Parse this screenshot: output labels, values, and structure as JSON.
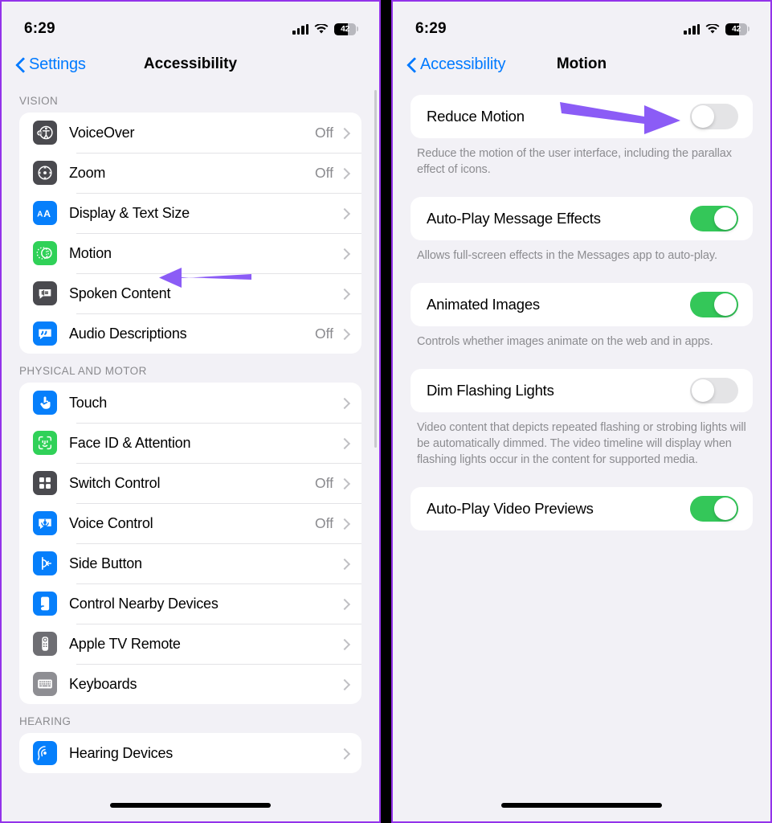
{
  "status_bar": {
    "time": "6:29",
    "battery_percent": "42",
    "cellular_icon": "cellular-bars-icon",
    "wifi_icon": "wifi-icon",
    "battery_icon": "battery-icon"
  },
  "colors": {
    "accent_blue": "#007AFF",
    "toggle_on_green": "#34C759",
    "toggle_off_gray": "#E4E4E6",
    "annotation_purple": "#8B5CF6",
    "page_background": "#F2F1F6",
    "card_background": "#FFFFFF"
  },
  "left_panel": {
    "nav": {
      "back_label": "Settings",
      "title": "Accessibility",
      "back_icon": "chevron-left-icon"
    },
    "sections": [
      {
        "header": "VISION",
        "rows": [
          {
            "label": "VoiceOver",
            "value": "Off",
            "icon": "voiceover-icon",
            "icon_bg": "#4A4A4F",
            "chevron": "chevron-right-icon"
          },
          {
            "label": "Zoom",
            "value": "Off",
            "icon": "zoom-icon",
            "icon_bg": "#4A4A4F",
            "chevron": "chevron-right-icon"
          },
          {
            "label": "Display & Text Size",
            "value": "",
            "icon": "display-text-size-icon",
            "icon_bg": "#067FFB",
            "chevron": "chevron-right-icon"
          },
          {
            "label": "Motion",
            "value": "",
            "icon": "motion-icon",
            "icon_bg": "#30D158",
            "chevron": "chevron-right-icon"
          },
          {
            "label": "Spoken Content",
            "value": "",
            "icon": "spoken-content-icon",
            "icon_bg": "#4A4A4F",
            "chevron": "chevron-right-icon"
          },
          {
            "label": "Audio Descriptions",
            "value": "Off",
            "icon": "audio-descriptions-icon",
            "icon_bg": "#067FFB",
            "chevron": "chevron-right-icon"
          }
        ]
      },
      {
        "header": "PHYSICAL AND MOTOR",
        "rows": [
          {
            "label": "Touch",
            "value": "",
            "icon": "touch-icon",
            "icon_bg": "#067FFB",
            "chevron": "chevron-right-icon"
          },
          {
            "label": "Face ID & Attention",
            "value": "",
            "icon": "face-id-icon",
            "icon_bg": "#30D158",
            "chevron": "chevron-right-icon"
          },
          {
            "label": "Switch Control",
            "value": "Off",
            "icon": "switch-control-icon",
            "icon_bg": "#4A4A4F",
            "chevron": "chevron-right-icon"
          },
          {
            "label": "Voice Control",
            "value": "Off",
            "icon": "voice-control-icon",
            "icon_bg": "#067FFB",
            "chevron": "chevron-right-icon"
          },
          {
            "label": "Side Button",
            "value": "",
            "icon": "side-button-icon",
            "icon_bg": "#067FFB",
            "chevron": "chevron-right-icon"
          },
          {
            "label": "Control Nearby Devices",
            "value": "",
            "icon": "nearby-devices-icon",
            "icon_bg": "#067FFB",
            "chevron": "chevron-right-icon"
          },
          {
            "label": "Apple TV Remote",
            "value": "",
            "icon": "apple-tv-remote-icon",
            "icon_bg": "#6E6E73",
            "chevron": "chevron-right-icon"
          },
          {
            "label": "Keyboards",
            "value": "",
            "icon": "keyboards-icon",
            "icon_bg": "#8E8E93",
            "chevron": "chevron-right-icon"
          }
        ]
      },
      {
        "header": "HEARING",
        "rows": [
          {
            "label": "Hearing Devices",
            "value": "",
            "icon": "hearing-devices-icon",
            "icon_bg": "#067FFB",
            "chevron": "chevron-right-icon"
          }
        ]
      }
    ]
  },
  "right_panel": {
    "nav": {
      "back_label": "Accessibility",
      "title": "Motion",
      "back_icon": "chevron-left-icon"
    },
    "settings": [
      {
        "label": "Reduce Motion",
        "state": "off",
        "description": "Reduce the motion of the user interface, including the parallax effect of icons."
      },
      {
        "label": "Auto-Play Message Effects",
        "state": "on",
        "description": "Allows full-screen effects in the Messages app to auto-play."
      },
      {
        "label": "Animated Images",
        "state": "on",
        "description": "Controls whether images animate on the web and in apps."
      },
      {
        "label": "Dim Flashing Lights",
        "state": "off",
        "description": "Video content that depicts repeated flashing or strobing lights will be automatically dimmed. The video timeline will display when flashing lights occur in the content for supported media."
      },
      {
        "label": "Auto-Play Video Previews",
        "state": "on",
        "description": ""
      }
    ]
  },
  "annotations": [
    {
      "name": "arrow-pointing-to-motion-row",
      "direction": "left",
      "color": "#8B5CF6"
    },
    {
      "name": "arrow-pointing-to-reduce-motion-toggle",
      "direction": "right",
      "color": "#8B5CF6"
    }
  ]
}
